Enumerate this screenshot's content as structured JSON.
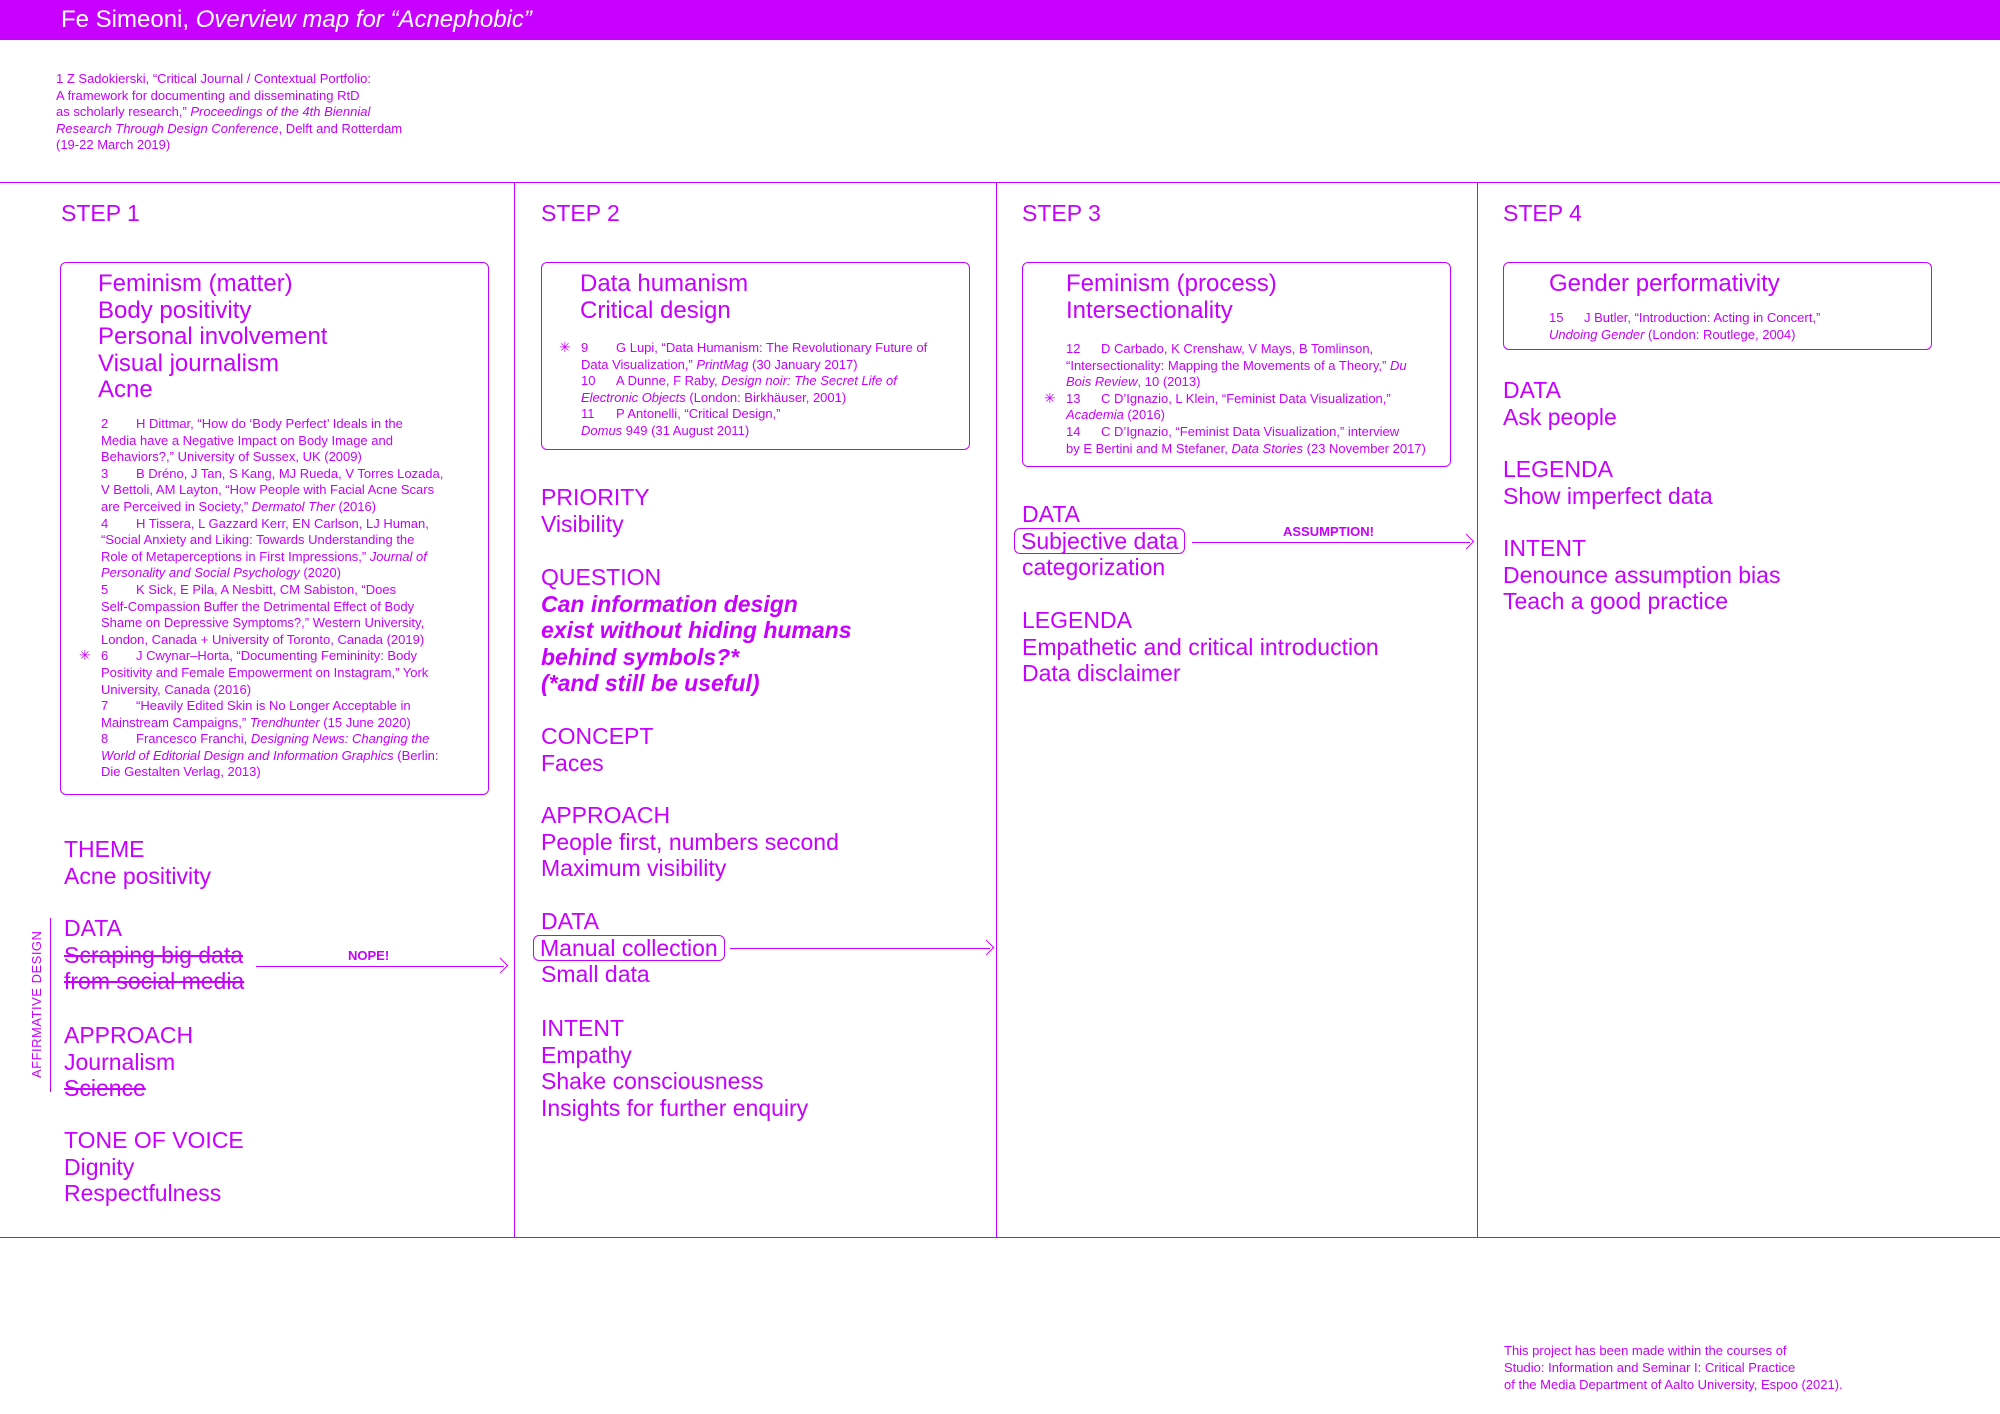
{
  "header": {
    "author": "Fe Simeoni,",
    "title": "Overview map for “Acnephobic”"
  },
  "ref1": {
    "l1": "1       Z Sadokierski, “Critical Journal / Contextual Portfolio:",
    "l2": "A framework for documenting and disseminating RtD",
    "l3a": "as scholarly research,” ",
    "l3b": "Proceedings of the 4th Biennial",
    "l4a": "Research Through Design Conference",
    "l4b": ", Delft and Rotterdam",
    "l5": "(19-22 March 2019)"
  },
  "steps": [
    "STEP 1",
    "STEP 2",
    "STEP 3",
    "STEP 4"
  ],
  "step1": {
    "topics": [
      "Feminism (matter)",
      "Body positivity",
      "Personal involvement",
      "Visual journalism",
      "Acne"
    ],
    "refs": {
      "r2n": "2",
      "r2a": "H Dittmar, “How do ‘Body Perfect’ Ideals in the",
      "r2b": "Media have a Negative Impact on Body Image and",
      "r2c": "Behaviors?,” University of Sussex, UK (2009)",
      "r3n": "3",
      "r3a": "B Dréno, J Tan, S Kang, MJ Rueda, V Torres Lozada,",
      "r3b": "V Bettoli, AM Layton, “How People with Facial Acne Scars",
      "r3c1": "are Perceived in Society,” ",
      "r3c2": "Dermatol Ther",
      "r3c3": " (2016)",
      "r4n": "4",
      "r4a": "H Tissera, L Gazzard Kerr, EN Carlson, LJ Human,",
      "r4b": "“Social Anxiety and Liking: Towards Understanding the",
      "r4c1": "Role of Metaperceptions in First Impressions,” ",
      "r4c2": "Journal of",
      "r4d1": "Personality and Social Psychology",
      "r4d2": " (2020)",
      "r5n": "5",
      "r5a": "K Sick, E Pila, A Nesbitt, CM Sabiston, “Does",
      "r5b": "Self-Compassion Buffer the Detrimental Effect of Body",
      "r5c": "Shame on Depressive Symptoms?,” Western University,",
      "r5d": "London, Canada + University of Toronto, Canada (2019)",
      "star": "✳",
      "r6n": "6",
      "r6a": "J Cwynar–Horta, “Documenting Femininity: Body",
      "r6b": "Positivity and Female Empowerment on Instagram,” York",
      "r6c": "University, Canada (2016)",
      "r7n": "7",
      "r7a": "“Heavily Edited Skin is No Longer Acceptable in",
      "r7b1": "Mainstream Campaigns,” ",
      "r7b2": "Trendhunter",
      "r7b3": " (15 June 2020)",
      "r8n": "8",
      "r8a1": "Francesco Franchi, ",
      "r8a2": "Designing News: Changing the",
      "r8b1": "World of Editorial Design and Information Graphics",
      "r8b2": " (Berlin:",
      "r8c": "Die Gestalten Verlag, 2013)"
    },
    "theme_h": "THEME",
    "theme_v": "Acne positivity",
    "data_h": "DATA",
    "data_v1": "Scraping big data",
    "data_v2": "from social media",
    "approach_h": "APPROACH",
    "approach_v1": "Journalism",
    "approach_v2": "Science",
    "tone_h": "TONE OF VOICE",
    "tone_v1": "Dignity",
    "tone_v2": "Respectfulness",
    "arrow_label": "NOPE!",
    "vertical_label": "AFFIRMATIVE DESIGN"
  },
  "step2": {
    "topics": [
      "Data humanism",
      "Critical design"
    ],
    "refs": {
      "star": "✳",
      "r9n": "9",
      "r9a": "G Lupi, “Data Humanism: The Revolutionary Future of",
      "r9b1": "Data Visualization,” ",
      "r9b2": "PrintMag",
      "r9b3": " (30 January 2017)",
      "r10n": "10",
      "r10a1": "A Dunne, F Raby, ",
      "r10a2": "Design noir: The Secret Life of",
      "r10b1": "Electronic Objects",
      "r10b2": " (London: Birkhäuser, 2001)",
      "r11n": "11",
      "r11a": "P Antonelli, “Critical Design,”",
      "r11b1": "Domus",
      "r11b2": " 949 (31 August 2011)"
    },
    "priority_h": "PRIORITY",
    "priority_v": "Visibility",
    "question_h": "QUESTION",
    "question": [
      "Can information design",
      "exist without hiding humans",
      "behind symbols?*",
      "(*and still be useful)"
    ],
    "concept_h": "CONCEPT",
    "concept_v": "Faces",
    "approach_h": "APPROACH",
    "approach_v1": "People first, numbers second",
    "approach_v2": "Maximum visibility",
    "data_h": "DATA",
    "data_v1": "Manual collection",
    "data_v2": "Small data",
    "intent_h": "INTENT",
    "intent": [
      "Empathy",
      "Shake consciousness",
      "Insights for further enquiry"
    ]
  },
  "step3": {
    "topics": [
      "Feminism (process)",
      "Intersectionality"
    ],
    "refs": {
      "star": "✳",
      "r12n": "12",
      "r12a": "D Carbado, K Crenshaw, V Mays, B Tomlinson,",
      "r12b1": "“Intersectionality: Mapping the Movements of a Theory,” ",
      "r12b2": "Du",
      "r12c1": "Bois Review",
      "r12c2": ", 10 (2013)",
      "r13n": "13",
      "r13a": "C D’Ignazio, L Klein, “Feminist Data Visualization,”",
      "r13b1": "Academia",
      "r13b2": " (2016)",
      "r14n": "14",
      "r14a": "C D’Ignazio, “Feminist Data Visualization,” interview",
      "r14b1": "by E Bertini and M Stefaner, ",
      "r14b2": "Data Stories",
      "r14b3": " (23 November 2017)"
    },
    "data_h": "DATA",
    "data_v1": "Subjective data",
    "data_v2": "categorization",
    "legenda_h": "LEGENDA",
    "legenda_v1": "Empathetic and critical introduction",
    "legenda_v2": "Data disclaimer",
    "arrow_label": "ASSUMPTION!"
  },
  "step4": {
    "topics": [
      "Gender performativity"
    ],
    "refs": {
      "r15n": "15",
      "r15a": "J Butler, “Introduction: Acting in Concert,”",
      "r15b1": "Undoing Gender",
      "r15b2": " (London: Routlege, 2004)"
    },
    "data_h": "DATA",
    "data_v": "Ask people",
    "legenda_h": "LEGENDA",
    "legenda_v": "Show imperfect data",
    "intent_h": "INTENT",
    "intent_v1": "Denounce assumption bias",
    "intent_v2": "Teach a good practice"
  },
  "footer": {
    "l1": "This project has been made within the courses of",
    "l2": "Studio: Information and Seminar I: Critical Practice",
    "l3": "of the Media Department of Aalto University, Espoo (2021)."
  },
  "colors": {
    "accent": "#c800ff",
    "background": "#ffffff"
  }
}
